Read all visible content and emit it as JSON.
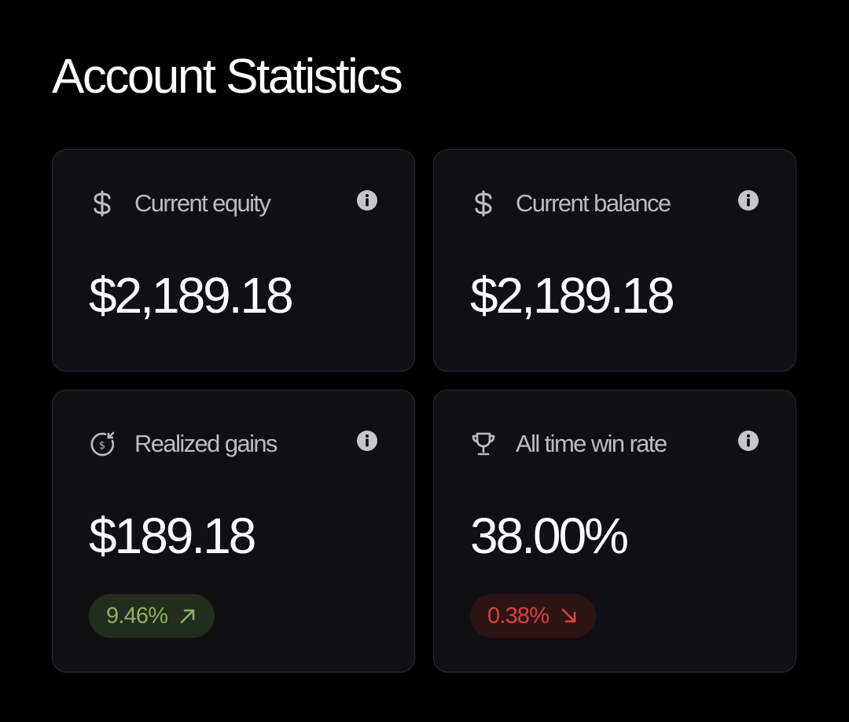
{
  "page": {
    "title": "Account Statistics"
  },
  "cards": {
    "current_equity": {
      "label": "Current equity",
      "value": "$2,189.18",
      "icon": "dollar-icon"
    },
    "current_balance": {
      "label": "Current balance",
      "value": "$2,189.18",
      "icon": "dollar-icon"
    },
    "realized_gains": {
      "label": "Realized gains",
      "value": "$189.18",
      "icon": "refund-coin-icon",
      "change": "9.46%",
      "change_direction": "up",
      "change_icon": "arrow-up-right-icon"
    },
    "win_rate": {
      "label": "All time win rate",
      "value": "38.00%",
      "icon": "trophy-icon",
      "change": "0.38%",
      "change_direction": "down",
      "change_icon": "arrow-down-right-icon"
    }
  },
  "icons": {
    "info": "info-icon"
  },
  "colors": {
    "background": "#000000",
    "card_background": "#0f1014",
    "card_border": "#2a2c31",
    "label": "#b9bcc3",
    "value": "#ffffff",
    "positive_text": "#8fae62",
    "positive_bg": "#232d1d",
    "negative_text": "#dd3f3f",
    "negative_bg": "#2d1415"
  }
}
